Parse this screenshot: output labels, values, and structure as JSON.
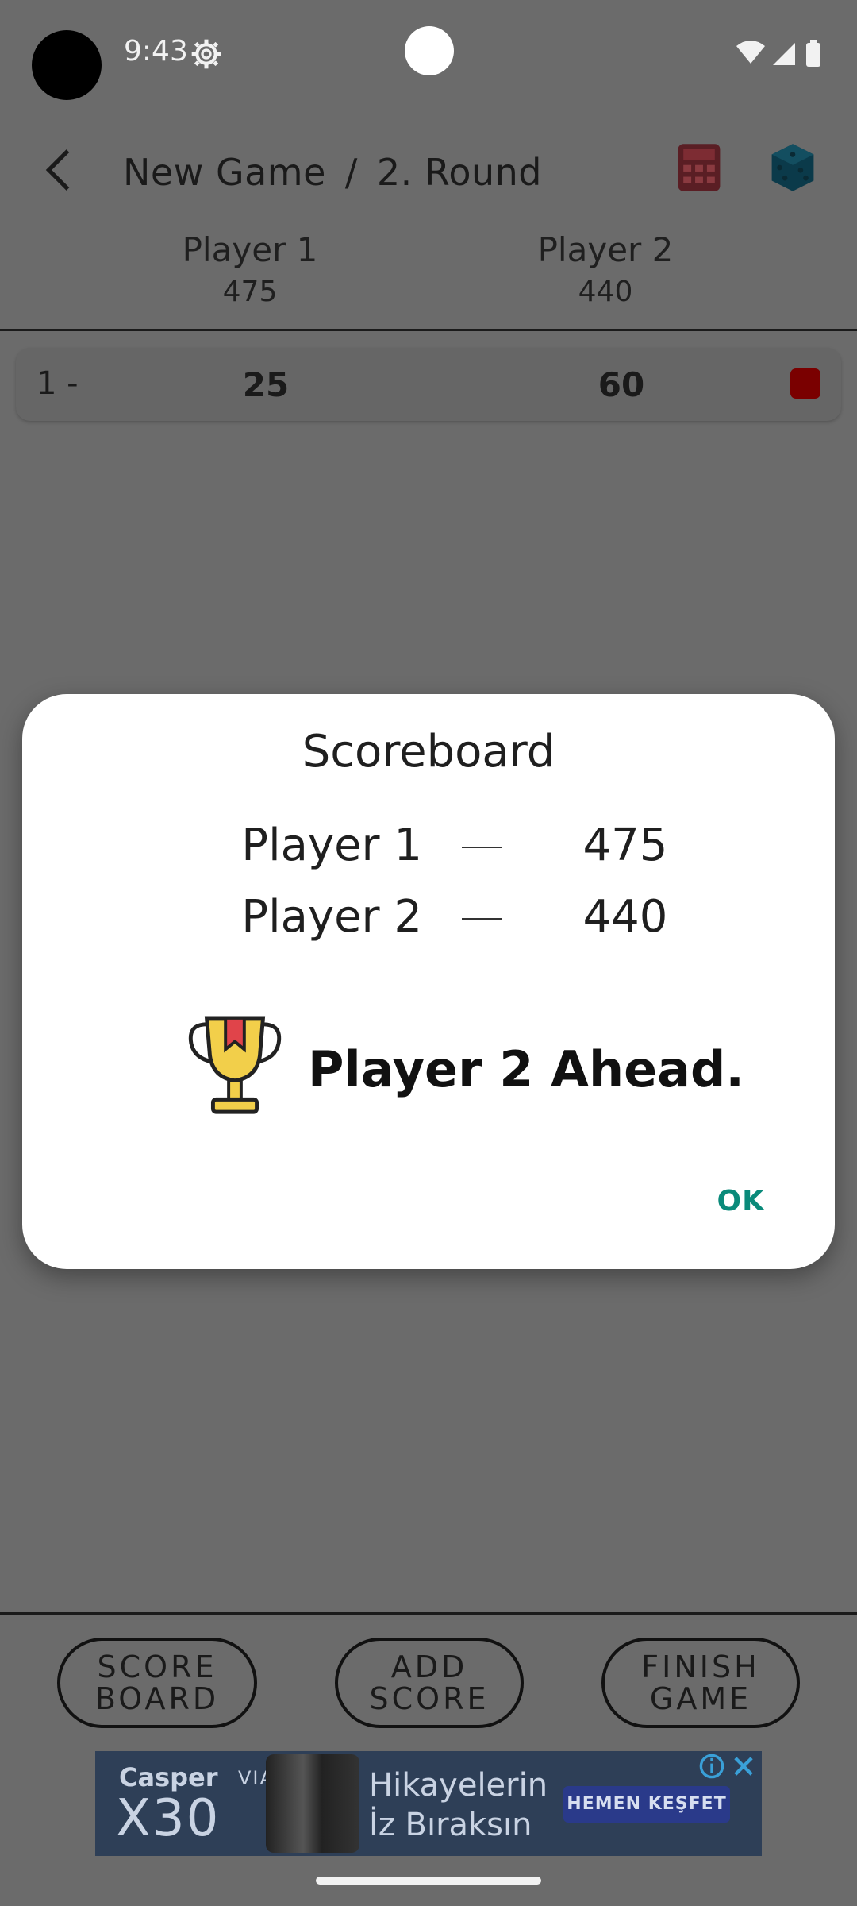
{
  "status_bar": {
    "time": "9:43"
  },
  "header": {
    "game_name": "New Game",
    "separator": "/",
    "round": "2. Round"
  },
  "players": [
    {
      "name": "Player 1",
      "total": "475"
    },
    {
      "name": "Player 2",
      "total": "440"
    }
  ],
  "rounds": [
    {
      "index": "1 -",
      "p1": "25",
      "p2": "60"
    }
  ],
  "buttons": {
    "scoreboard": "SCORE\nBOARD",
    "add_score": "ADD\nSCORE",
    "finish_game": "FINISH\nGAME"
  },
  "ad": {
    "brand": "Casper",
    "via": "VIA",
    "model": "X30",
    "headline": "Hikayelerin\nİz Bıraksın",
    "cta": "HEMEN KEŞFET"
  },
  "dialog": {
    "title": "Scoreboard",
    "rows": [
      {
        "name": "Player 1",
        "score": "475"
      },
      {
        "name": "Player 2",
        "score": "440"
      }
    ],
    "leader_text": "Player 2 Ahead.",
    "ok_label": "OK"
  },
  "colors": {
    "accent_ok": "#0a8a7a",
    "delete_red": "#7a0000",
    "scrim": "#6b6b6b"
  }
}
